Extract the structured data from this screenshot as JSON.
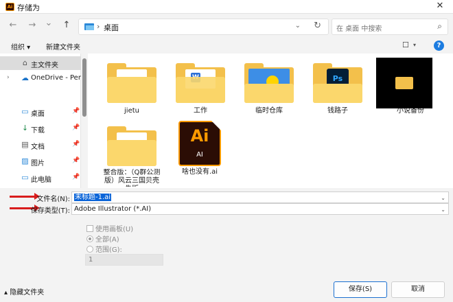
{
  "window": {
    "title": "存储为",
    "app_badge": "Ai",
    "close_glyph": "✕"
  },
  "nav": {
    "back_glyph": "←",
    "forward_glyph": "→",
    "history_glyph": "⌄",
    "up_glyph": "↑",
    "address_sep": "›",
    "address": "桌面",
    "address_dd": "⌄",
    "refresh_glyph": "↻",
    "search_placeholder": "在 桌面 中搜索",
    "search_glyph": "⌕"
  },
  "toolbar": {
    "organize": "组织 ▾",
    "new_folder": "新建文件夹",
    "view_glyph": "☐",
    "view_dd": "▾",
    "help": "?"
  },
  "sidebar": {
    "items": [
      {
        "label": "主文件夹",
        "icon": "⌂",
        "arrow": "",
        "pin": ""
      },
      {
        "label": "OneDrive - Per",
        "icon": "☁",
        "arrow": "›",
        "pin": ""
      },
      {
        "label": "桌面",
        "icon": "▭",
        "arrow": "",
        "pin": "📌"
      },
      {
        "label": "下载",
        "icon": "↓",
        "arrow": "",
        "pin": "📌"
      },
      {
        "label": "文档",
        "icon": "▤",
        "arrow": "",
        "pin": "📌"
      },
      {
        "label": "图片",
        "icon": "▨",
        "arrow": "",
        "pin": "📌"
      },
      {
        "label": "此电脑",
        "icon": "▭",
        "arrow": "",
        "pin": "📌"
      }
    ]
  },
  "files": [
    {
      "label": "jietu",
      "type": "folder"
    },
    {
      "label": "工作",
      "type": "folder",
      "badge": "W"
    },
    {
      "label": "临时仓库",
      "type": "folder"
    },
    {
      "label": "钱路子",
      "type": "folder",
      "badge": "Ps"
    },
    {
      "label": "小说备份",
      "type": "image-folder"
    },
    {
      "label": "整合版：（Q群公测版）风云三国贝壳先版",
      "type": "folder"
    },
    {
      "label": "啥也没有.ai",
      "type": "ai-file",
      "big": "Ai",
      "small": "AI"
    }
  ],
  "form": {
    "filename_label": "文件名(N):",
    "filename_value": "未标题-1.ai",
    "filetype_label": "保存类型(T):",
    "filetype_value": "Adobe Illustrator (*.AI)",
    "dd_glyph": "⌄",
    "use_artboards": "使用画板(U)",
    "all_option": "全部(A)",
    "range_option": "范围(G):",
    "range_value": "1"
  },
  "footer": {
    "hide_folders": "隐藏文件夹",
    "hide_glyph": "▴",
    "save": "保存(S)",
    "cancel": "取消"
  },
  "colors": {
    "accent": "#0a64d8",
    "folder": "#f3c04b",
    "arrow_red": "#d81c1c",
    "ai_orange": "#ff9a00"
  }
}
